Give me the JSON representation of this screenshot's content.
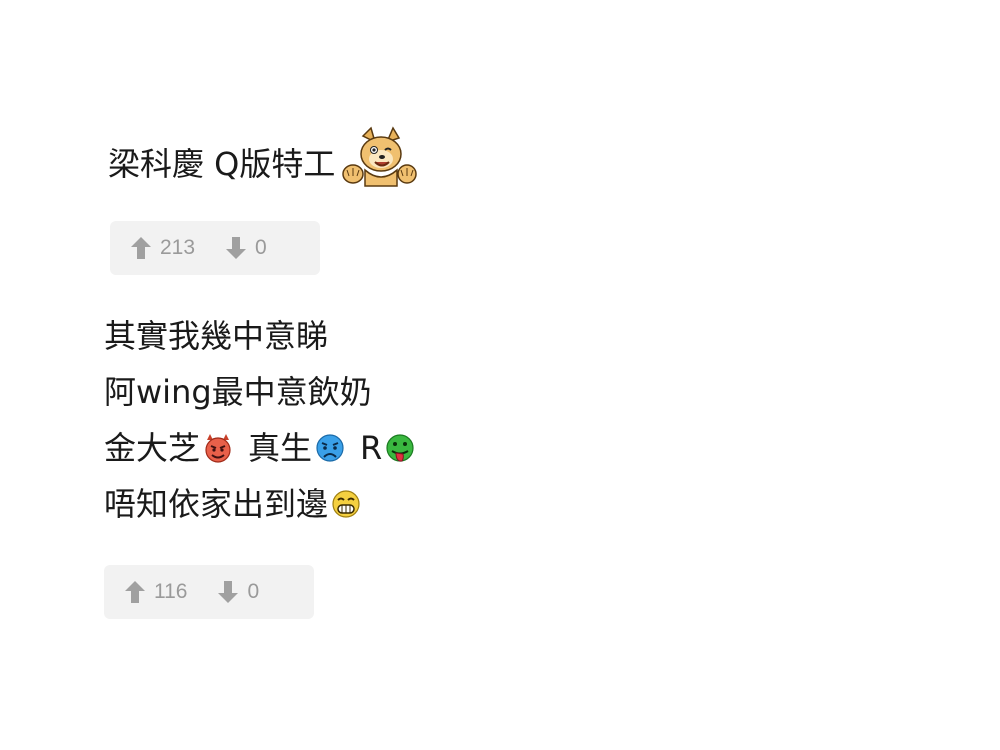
{
  "comments": [
    {
      "lines": [
        "梁科慶 Q版特工"
      ],
      "emoji": [
        "dog-sticker"
      ],
      "upvotes": "213",
      "downvotes": "0"
    },
    {
      "lines": [
        "其實我幾中意睇",
        "阿wing最中意飲奶",
        "金大芝",
        "真生",
        "R",
        "唔知依家出到邊"
      ],
      "emoji": [
        "devil-emoji",
        "sad-emoji",
        "tongue-emoji",
        "grin-emoji"
      ],
      "upvotes": "116",
      "downvotes": "0"
    }
  ]
}
